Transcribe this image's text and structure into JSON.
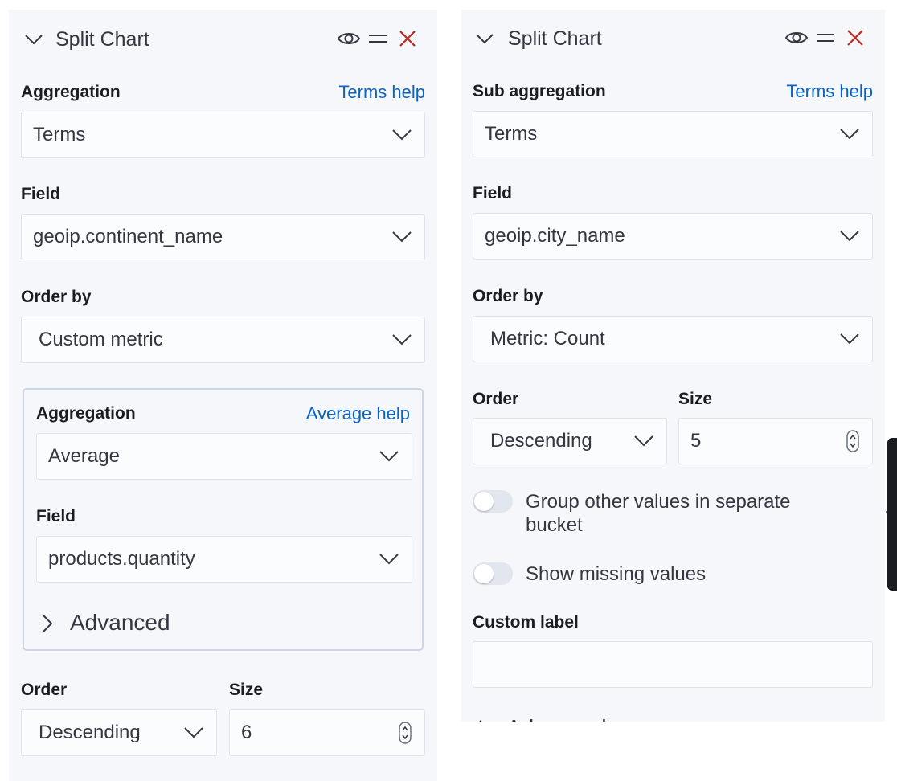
{
  "left": {
    "header": {
      "title": "Split Chart"
    },
    "aggregation": {
      "label": "Aggregation",
      "help": "Terms help",
      "value": "Terms"
    },
    "field": {
      "label": "Field",
      "value": "geoip.continent_name"
    },
    "order_by": {
      "label": "Order by",
      "value": "Custom metric"
    },
    "custom_metric": {
      "aggregation": {
        "label": "Aggregation",
        "help": "Average help",
        "value": "Average"
      },
      "field": {
        "label": "Field",
        "value": "products.quantity"
      },
      "advanced": "Advanced"
    },
    "order": {
      "label": "Order",
      "value": "Descending"
    },
    "size": {
      "label": "Size",
      "value": "6"
    }
  },
  "right": {
    "header": {
      "title": "Split Chart"
    },
    "sub_aggregation": {
      "label": "Sub aggregation",
      "help": "Terms help",
      "value": "Terms"
    },
    "field": {
      "label": "Field",
      "value": "geoip.city_name"
    },
    "order_by": {
      "label": "Order by",
      "value": "Metric: Count"
    },
    "order": {
      "label": "Order",
      "value": "Descending"
    },
    "size": {
      "label": "Size",
      "value": "5"
    },
    "group_other": {
      "label_line1": "Group other values in separate",
      "label_line2": "bucket",
      "enabled": false
    },
    "show_missing": {
      "label": "Show missing values",
      "enabled": false
    },
    "custom_label": {
      "label": "Custom label",
      "value": ""
    },
    "advanced": "Advanced"
  },
  "colors": {
    "link": "#0b64c4",
    "remove": "#bd271e",
    "panel_bg": "#f6f7fa"
  },
  "icons": {
    "collapse": "chevron-down-icon",
    "toggle_visibility": "eye-icon",
    "drag": "drag-handle-icon",
    "remove": "close-icon",
    "select_caret": "chevron-down-icon",
    "advanced_expand": "chevron-right-icon",
    "number_spinner": "spinner-icon"
  }
}
